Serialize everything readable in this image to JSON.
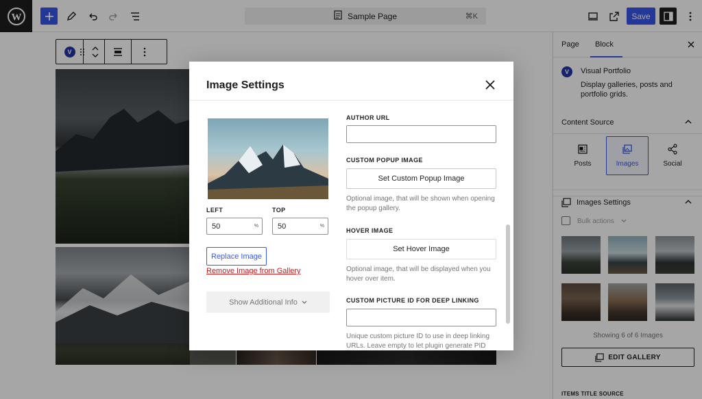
{
  "topbar": {
    "document_title": "Sample Page",
    "shortcut": "⌘K",
    "save_label": "Save"
  },
  "block_toolbar": {
    "badge": "V"
  },
  "modal": {
    "title": "Image Settings",
    "left_label": "LEFT",
    "left_value": "50",
    "top_label": "TOP",
    "top_value": "50",
    "unit": "%",
    "replace_label": "Replace Image",
    "remove_label": "Remove Image from Gallery",
    "additional_label": "Show Additional Info",
    "author_url_label": "AUTHOR URL",
    "author_url_value": "",
    "popup_label": "CUSTOM POPUP IMAGE",
    "popup_button": "Set Custom Popup Image",
    "popup_help": "Optional image, that will be shown when opening the popup gallery.",
    "hover_label": "HOVER IMAGE",
    "hover_button": "Set Hover Image",
    "hover_help": "Optional image, that will be displayed when you hover over item.",
    "picture_id_label": "CUSTOM PICTURE ID FOR DEEP LINKING",
    "picture_id_value": "",
    "picture_id_help": "Unique custom picture ID to use in deep linking URLs. Leave empty to let plugin generate PID"
  },
  "sidebar": {
    "tabs": [
      "Page",
      "Block"
    ],
    "active_tab": "Block",
    "plugin_name": "Visual Portfolio",
    "plugin_desc": "Display galleries, posts and portfolio grids.",
    "content_source_title": "Content Source",
    "sources": [
      "Posts",
      "Images",
      "Social"
    ],
    "active_source": "Images",
    "images_settings_title": "Images Settings",
    "bulk_actions": "Bulk actions",
    "showing": "Showing 6 of 6 Images",
    "edit_gallery": "EDIT GALLERY",
    "items_title_source": "ITEMS TITLE SOURCE"
  },
  "colors": {
    "accent": "#3858e9",
    "danger": "#cc1818",
    "dark": "#1e1e1e"
  }
}
